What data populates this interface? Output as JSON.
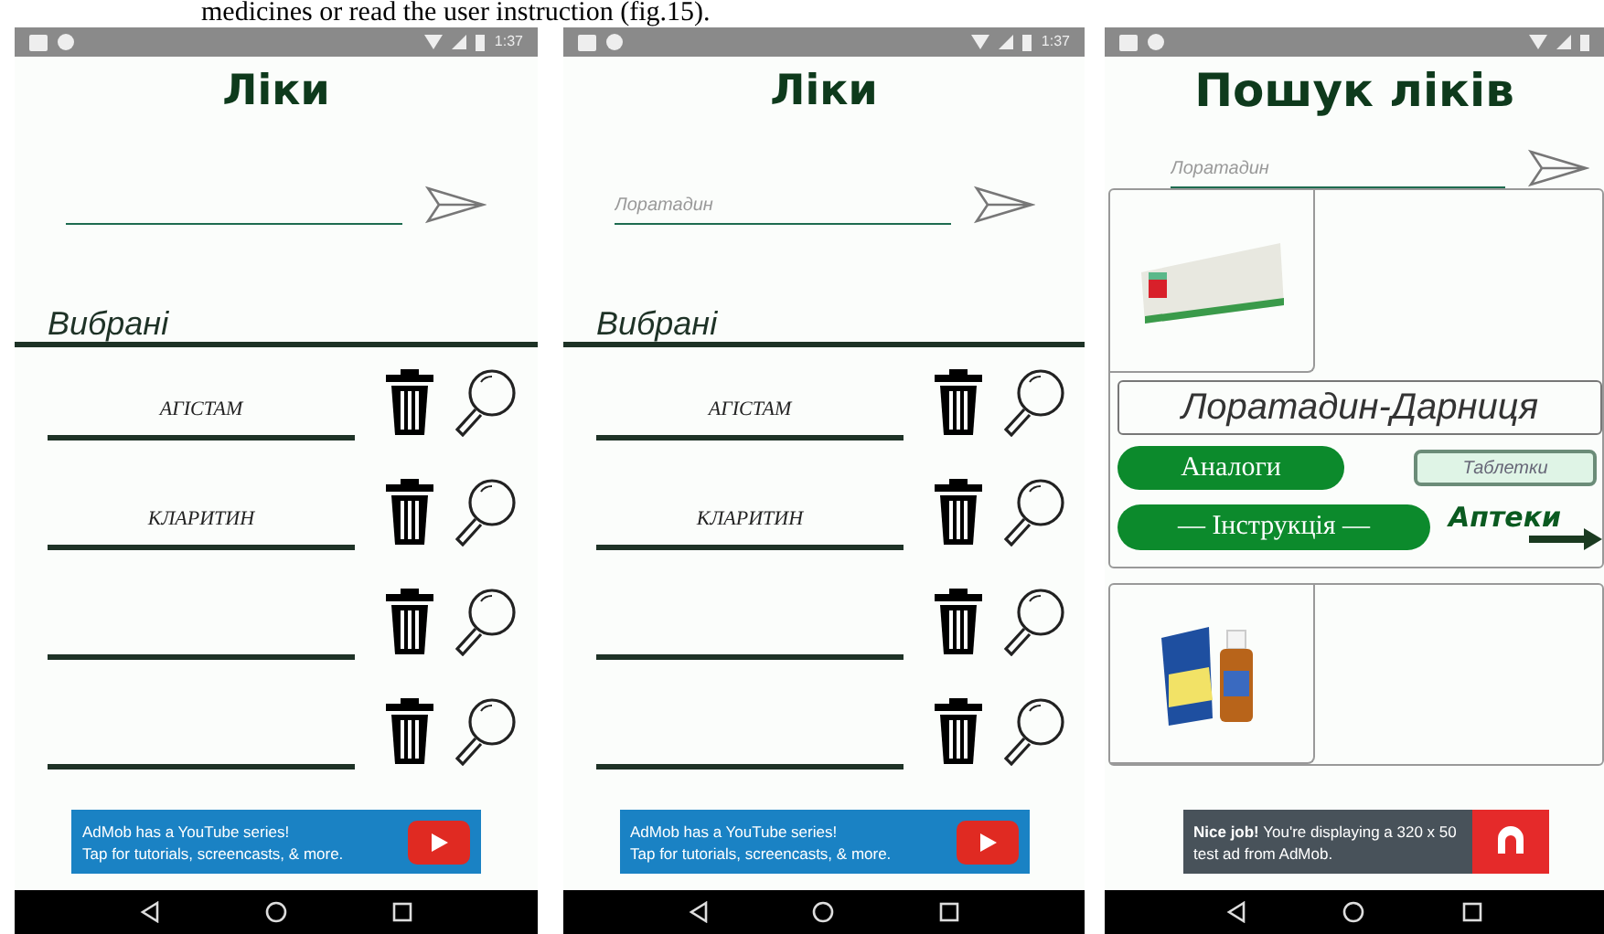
{
  "caption": "medicines or read the user instruction (fig.15).",
  "phones": [
    {
      "kind": "favorites",
      "status": {
        "time": "1:37"
      },
      "title": "Ліки",
      "section": "Вибрані",
      "rows": [
        {
          "kind": "filled",
          "name": "АГІСТАМ"
        },
        {
          "kind": "filled",
          "name": "КЛАРИТИН"
        },
        {
          "kind": "blank"
        },
        {
          "kind": "blank"
        }
      ],
      "ad": {
        "kind": "youtube",
        "text": "AdMob has a YouTube series!\nTap for tutorials, screencasts, & more."
      }
    },
    {
      "kind": "favorites",
      "status": {
        "time": "1:37"
      },
      "title": "Ліки",
      "search": {
        "value": "Лоратадин"
      },
      "section": "Вибрані",
      "rows": [
        {
          "kind": "filled",
          "name": "АГІСТАМ"
        },
        {
          "kind": "filled",
          "name": "КЛАРИТИН"
        },
        {
          "kind": "blank"
        },
        {
          "kind": "blank"
        }
      ],
      "ad": {
        "kind": "youtube",
        "text": "AdMob has a YouTube series!\nTap for tutorials, screencasts, & more."
      }
    },
    {
      "kind": "results",
      "title": "Пошук ліків",
      "search": {
        "value": "Лоратадин"
      },
      "results": [
        {
          "kind": "detailed",
          "name": "Лоратадин-Дарниця",
          "analogs": "Аналоги",
          "form": "Таблетки",
          "instruction": "— Інструкція —",
          "pharmacies": "Аптеки"
        },
        {
          "kind": "simple"
        }
      ],
      "ad": {
        "kind": "test",
        "text": "**Nice job!** You're displaying a 320 x 50 test ad from AdMob."
      }
    }
  ]
}
